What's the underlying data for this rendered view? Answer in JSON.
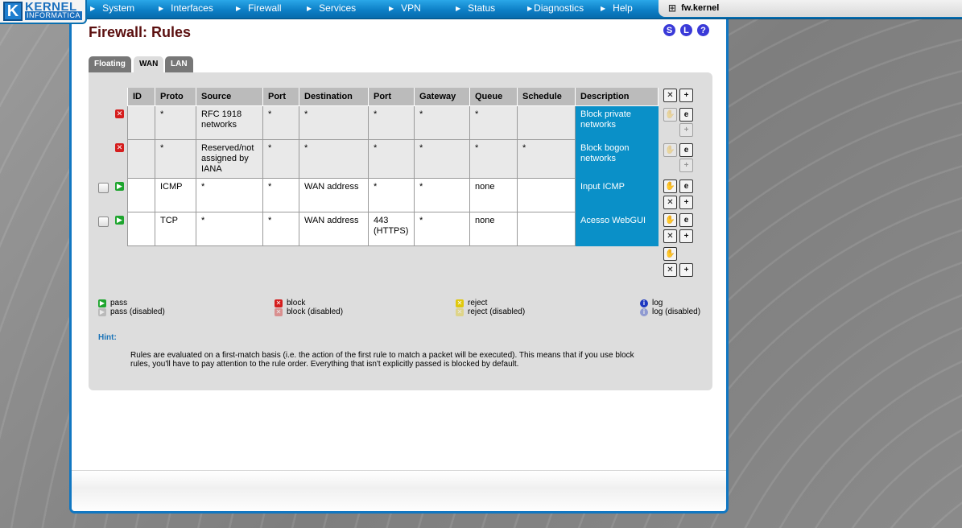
{
  "brand": {
    "logo_main": "KERNEL",
    "logo_sub": "INFORMATICA"
  },
  "nav": {
    "items": [
      "System",
      "Interfaces",
      "Firewall",
      "Services",
      "VPN",
      "Status",
      "Diagnostics",
      "Help"
    ],
    "hostname": "fw.kernel"
  },
  "page": {
    "title": "Firewall: Rules",
    "header_icons": [
      "S",
      "L",
      "?"
    ]
  },
  "tabs": [
    {
      "label": "Floating",
      "active": false
    },
    {
      "label": "WAN",
      "active": true
    },
    {
      "label": "LAN",
      "active": false
    }
  ],
  "table": {
    "headers": [
      "ID",
      "Proto",
      "Source",
      "Port",
      "Destination",
      "Port",
      "Gateway",
      "Queue",
      "Schedule",
      "Description"
    ],
    "rows": [
      {
        "status": "block",
        "id": "",
        "proto": "*",
        "source": "RFC 1918 networks",
        "src_port": "*",
        "destination": "*",
        "dst_port": "*",
        "gateway": "*",
        "queue": "*",
        "schedule": "",
        "description": "Block private networks"
      },
      {
        "status": "block",
        "id": "",
        "proto": "*",
        "source": "Reserved/not assigned by IANA",
        "src_port": "*",
        "destination": "*",
        "dst_port": "*",
        "gateway": "*",
        "queue": "*",
        "schedule": "*",
        "description": "Block bogon networks"
      },
      {
        "status": "pass",
        "id": "",
        "proto": "ICMP",
        "source": "*",
        "src_port": "*",
        "destination": "WAN address",
        "dst_port": "*",
        "gateway": "*",
        "queue": "none",
        "schedule": "",
        "description": "Input ICMP"
      },
      {
        "status": "pass",
        "id": "",
        "proto": "TCP",
        "source": "*",
        "src_port": "*",
        "destination": "WAN address",
        "dst_port": "443 (HTTPS)",
        "gateway": "*",
        "queue": "none",
        "schedule": "",
        "description": "Acesso WebGUI"
      }
    ]
  },
  "legend": {
    "pass": "pass",
    "pass_disabled": "pass (disabled)",
    "block": "block",
    "block_disabled": "block (disabled)",
    "reject": "reject",
    "reject_disabled": "reject (disabled)",
    "log": "log",
    "log_disabled": "log (disabled)"
  },
  "hint": {
    "label": "Hint:",
    "text": "Rules are evaluated on a first-match basis (i.e. the action of the first rule to match a packet will be executed). This means that if you use block rules, you'll have to pay attention to the rule order. Everything that isn't explicitly passed is blocked by default."
  },
  "colors": {
    "nav_blue": "#0d7fc6",
    "desc_bg": "#0a90c8",
    "title": "#5b0f0f",
    "hint": "#1a73b8"
  },
  "icons": {
    "block": "block-icon",
    "pass": "pass-icon",
    "reject": "reject-icon",
    "log": "log-icon",
    "edit": "edit-icon",
    "delete": "delete-icon",
    "add": "add-icon",
    "move": "move-icon"
  }
}
